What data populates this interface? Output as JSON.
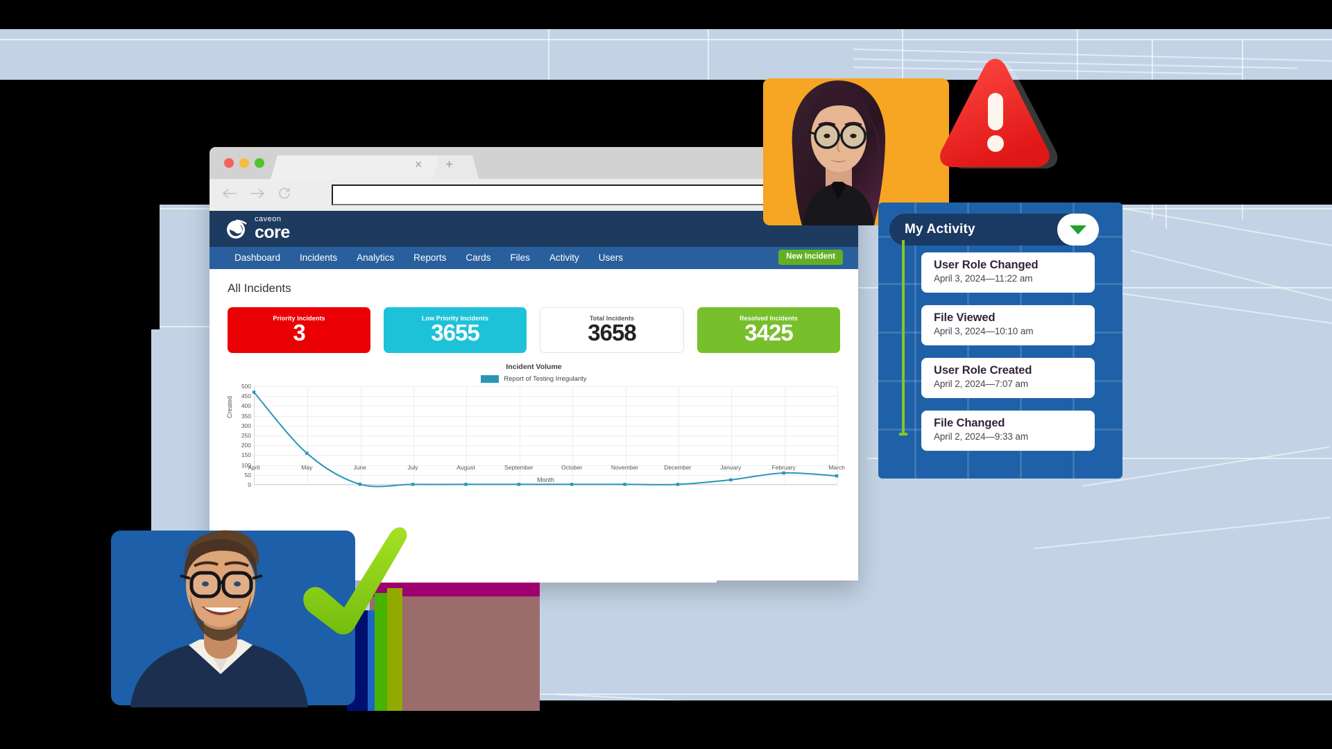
{
  "browser": {
    "back_icon": "back-arrow-icon",
    "forward_icon": "forward-arrow-icon",
    "reload_icon": "reload-icon",
    "tab_close": "×",
    "tab_new": "+",
    "url_value": "",
    "url_placeholder": ""
  },
  "app": {
    "logo_sub": "caveon",
    "logo_main": "core",
    "nav": [
      {
        "label": "Dashboard"
      },
      {
        "label": "Incidents"
      },
      {
        "label": "Analytics"
      },
      {
        "label": "Reports"
      },
      {
        "label": "Cards"
      },
      {
        "label": "Files"
      },
      {
        "label": "Activity"
      },
      {
        "label": "Users"
      }
    ],
    "new_incident_label": "New Incident",
    "page_title": "All Incidents",
    "cards": [
      {
        "label": "Priority Incidents",
        "value": "3",
        "bg": "#ea0005",
        "style": "solid"
      },
      {
        "label": "Low Priority Incidents",
        "value": "3655",
        "bg": "#1ec2d8",
        "style": "solid"
      },
      {
        "label": "Total Incidents",
        "value": "3658",
        "bg": "#ffffff",
        "style": "plain"
      },
      {
        "label": "Resolved Incidents",
        "value": "3425",
        "bg": "#78bf2c",
        "style": "solid"
      }
    ]
  },
  "chart_data": {
    "type": "line",
    "title": "Incident Volume",
    "xlabel": "Month",
    "ylabel": "Created",
    "ylim": [
      0,
      500
    ],
    "yticks": [
      0,
      50,
      100,
      150,
      200,
      250,
      300,
      350,
      400,
      450,
      500
    ],
    "grid": true,
    "legend_position": "top-center",
    "series_color": "#2b95b8",
    "categories": [
      "April",
      "May",
      "June",
      "July",
      "August",
      "September",
      "October",
      "November",
      "December",
      "January",
      "February",
      "March"
    ],
    "series": [
      {
        "name": "Report of Testing Irregularity",
        "values": [
          470,
          160,
          3,
          2,
          2,
          2,
          2,
          2,
          2,
          25,
          60,
          45
        ]
      }
    ]
  },
  "activity": {
    "title": "My Activity",
    "toggle_icon": "chevron-down-icon",
    "items": [
      {
        "title": "User Role Changed",
        "date": "April 3, 2024—11:22 am"
      },
      {
        "title": "File Viewed",
        "date": "April 3, 2024—10:10 am"
      },
      {
        "title": "User Role Created",
        "date": "April 2, 2024—7:07 am"
      },
      {
        "title": "File Changed",
        "date": "April 2, 2024—9:33 am"
      }
    ]
  },
  "decor": {
    "warning_icon": "warning-triangle-icon",
    "check_icon": "green-checkmark-icon",
    "photo_orange": "woman-portrait-photo",
    "photo_blue": "man-portrait-photo"
  },
  "colors": {
    "background": "#c3d3e5",
    "header": "#1d3a5f",
    "nav": "#2a5f9e",
    "accent_green": "#62b022",
    "panel_blue": "#1f61a8",
    "panel_header": "#1a3a63",
    "timeline_green": "#86c722"
  }
}
